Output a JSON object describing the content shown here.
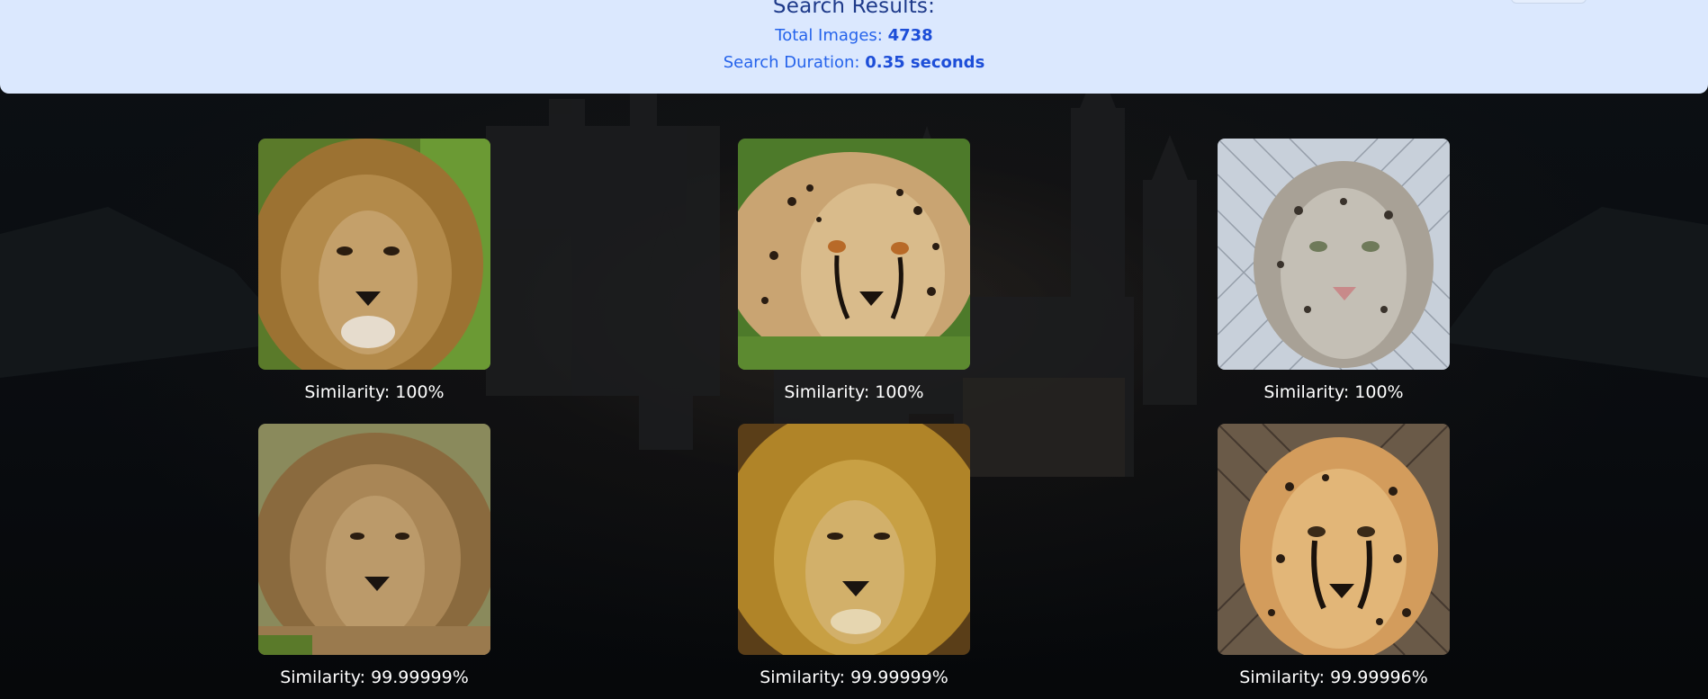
{
  "header": {
    "title": "Search Results:",
    "total_images_label": "Total Images:",
    "total_images_value": "4738",
    "duration_label": "Search Duration:",
    "duration_value": "0.35 seconds"
  },
  "results": [
    {
      "animal": "lion",
      "similarity_label": "Similarity: 100%"
    },
    {
      "animal": "cheetah",
      "similarity_label": "Similarity: 100%"
    },
    {
      "animal": "snow-leopard",
      "similarity_label": "Similarity: 100%"
    },
    {
      "animal": "lion",
      "similarity_label": "Similarity: 99.99999%"
    },
    {
      "animal": "lion",
      "similarity_label": "Similarity: 99.99999%"
    },
    {
      "animal": "cheetah",
      "similarity_label": "Similarity: 99.99996%"
    }
  ],
  "colors": {
    "header_bg": "#dbe8fe",
    "title": "#1e3a8a",
    "stat": "#2563eb",
    "page_bg": "#07090c"
  }
}
